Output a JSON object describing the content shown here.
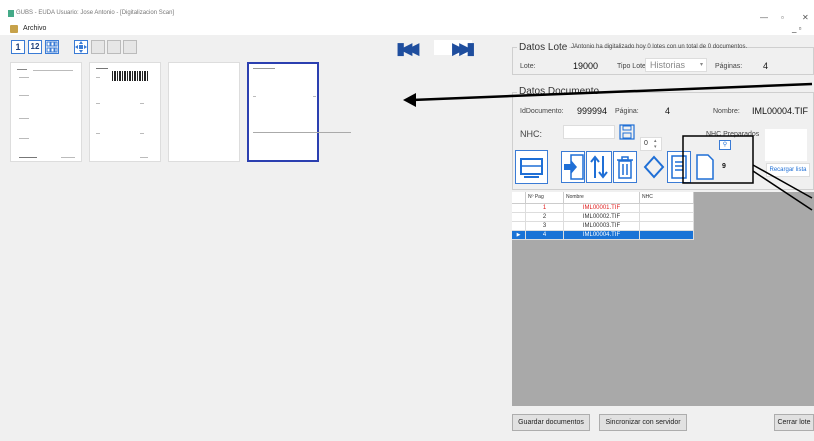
{
  "window": {
    "title": "GUBS - EUDA Usuario: Jose Antonio - [Digitalizacion Scan]",
    "minimize": "—",
    "maximize": "▫",
    "close": "✕"
  },
  "menu": {
    "file_label": "Archivo",
    "mdi_controls": "_ ▫"
  },
  "toolbar": {
    "view_one": "1",
    "view_two": "12"
  },
  "lote": {
    "group_title": "Datos Lote",
    "status_message": "JAntonio ha digitalizado hoy 0 lotes con un total de 0 documentos.",
    "lote_label": "Lote:",
    "lote_value": "19000",
    "tipo_label": "Tipo Lote:",
    "tipo_value": "Historias",
    "paginas_label": "Páginas:",
    "paginas_value": "4"
  },
  "documento": {
    "group_title": "Datos Documento",
    "id_label": "IdDocumento:",
    "id_value": "999994",
    "pagina_label": "Página:",
    "pagina_value": "4",
    "nombre_label": "Nombre:",
    "nombre_value": "IML00004.TIF",
    "nhc_label": "NHC:",
    "nhc_value": "",
    "spinner_value": "0",
    "nhc_preparados_label": "NHC Preparados",
    "count_value": "9",
    "recargar_label": "Recargar lista"
  },
  "table": {
    "columns": [
      "Nº Pag",
      "Nombre",
      "NHC"
    ],
    "rows": [
      {
        "pag": "1",
        "nombre": "IML00001.TIF",
        "nhc": "",
        "state": "error"
      },
      {
        "pag": "2",
        "nombre": "IML00002.TIF",
        "nhc": "",
        "state": "normal"
      },
      {
        "pag": "3",
        "nombre": "IML00003.TIF",
        "nhc": "",
        "state": "normal"
      },
      {
        "pag": "4",
        "nombre": "IML00004.TIF",
        "nhc": "",
        "state": "selected"
      }
    ]
  },
  "buttons": {
    "guardar": "Guardar documentos",
    "sincronizar": "Sincronizar con servidor",
    "cerrar": "Cerrar lote"
  },
  "colors": {
    "accent": "#1a73d6",
    "error_text": "#e02020",
    "nav_arrows": "#1f4e9e",
    "selected_thumb_border": "#2b3fb0"
  }
}
